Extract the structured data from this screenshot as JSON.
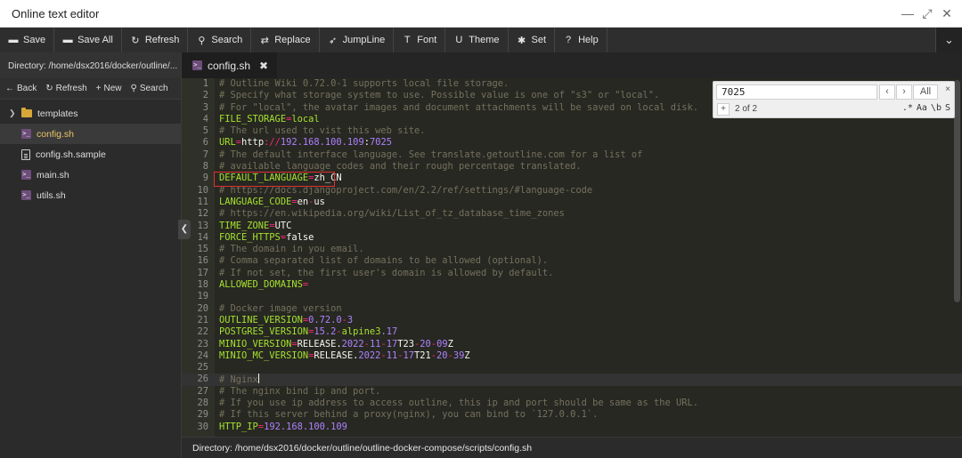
{
  "window": {
    "title": "Online text editor"
  },
  "toolbar": [
    {
      "label": "Save",
      "icon": "▬"
    },
    {
      "label": "Save All",
      "icon": "▬"
    },
    {
      "label": "Refresh",
      "icon": "↻"
    },
    {
      "label": "Search",
      "icon": "⚲"
    },
    {
      "label": "Replace",
      "icon": "⇄"
    },
    {
      "label": "JumpLine",
      "icon": "➶"
    },
    {
      "label": "Font",
      "icon": "T"
    },
    {
      "label": "Theme",
      "icon": "U"
    },
    {
      "label": "Set",
      "icon": "✱"
    },
    {
      "label": "Help",
      "icon": "?"
    }
  ],
  "sidebar": {
    "directory": "Directory: /home/dsx2016/docker/outline/...",
    "actions": [
      {
        "label": "Back",
        "icon": "←"
      },
      {
        "label": "Refresh",
        "icon": "↻"
      },
      {
        "label": "New",
        "icon": "+"
      },
      {
        "label": "Search",
        "icon": "⚲"
      }
    ],
    "items": [
      {
        "label": "templates",
        "type": "folder"
      },
      {
        "label": "config.sh",
        "type": "sh",
        "active": true
      },
      {
        "label": "config.sh.sample",
        "type": "doc"
      },
      {
        "label": "main.sh",
        "type": "sh"
      },
      {
        "label": "utils.sh",
        "type": "sh"
      }
    ]
  },
  "tab": {
    "label": "config.sh",
    "close": "✖"
  },
  "search": {
    "query": "7025",
    "prev": "‹",
    "next": "›",
    "all": "All",
    "close": "×",
    "plus": "+",
    "count": "2 of 2",
    "options": [
      ".*",
      "Aa",
      "\\b",
      "S"
    ]
  },
  "editor": {
    "current_line": 26,
    "lines": [
      [
        [
          "c-cm",
          "# Outline Wiki 0.72.0-1 supports local file storage."
        ]
      ],
      [
        [
          "c-cm",
          "# Specify what storage system to use. Possible value is one of \"s3\" or \"local\"."
        ]
      ],
      [
        [
          "c-cm",
          "# For \"local\", the avatar images and document attachments will be saved on local disk."
        ]
      ],
      [
        [
          "c-key",
          "FILE_STORAGE"
        ],
        [
          "c-op",
          "="
        ],
        [
          "c-key",
          "local"
        ]
      ],
      [
        [
          "c-cm",
          "# The url used to vist this web site."
        ]
      ],
      [
        [
          "c-key",
          "URL"
        ],
        [
          "c-op",
          "="
        ],
        [
          "c-txt",
          "http"
        ],
        [
          "c-op",
          "://"
        ],
        [
          "c-num",
          "192.168.100.109"
        ],
        [
          "c-txt",
          ":"
        ],
        [
          "c-num",
          "7025"
        ]
      ],
      [
        [
          "c-cm",
          "# The default interface language. See translate.getoutline.com for a list of"
        ]
      ],
      [
        [
          "c-cm",
          "# available language codes and their rough percentage translated."
        ]
      ],
      [
        [
          "c-key",
          "DEFAULT_LANGUAGE"
        ],
        [
          "c-op",
          "="
        ],
        [
          "c-txt",
          "zh_CN"
        ]
      ],
      [
        [
          "c-cm",
          "# https://docs.djangoproject.com/en/2.2/ref/settings/#language-code"
        ]
      ],
      [
        [
          "c-key",
          "LANGUAGE_CODE"
        ],
        [
          "c-op",
          "="
        ],
        [
          "c-txt",
          "en"
        ],
        [
          "c-op",
          "-"
        ],
        [
          "c-txt",
          "us"
        ]
      ],
      [
        [
          "c-cm",
          "# https://en.wikipedia.org/wiki/List_of_tz_database_time_zones"
        ]
      ],
      [
        [
          "c-key",
          "TIME_ZONE"
        ],
        [
          "c-op",
          "="
        ],
        [
          "c-txt",
          "UTC"
        ]
      ],
      [
        [
          "c-key",
          "FORCE_HTTPS"
        ],
        [
          "c-op",
          "="
        ],
        [
          "c-txt",
          "false"
        ]
      ],
      [
        [
          "c-cm",
          "# The domain in you email."
        ]
      ],
      [
        [
          "c-cm",
          "# Comma separated list of domains to be allowed (optional)."
        ]
      ],
      [
        [
          "c-cm",
          "# If not set, the first user's domain is allowed by default."
        ]
      ],
      [
        [
          "c-key",
          "ALLOWED_DOMAINS"
        ],
        [
          "c-op",
          "="
        ]
      ],
      [],
      [
        [
          "c-cm",
          "# Docker image version"
        ]
      ],
      [
        [
          "c-key",
          "OUTLINE_VERSION"
        ],
        [
          "c-op",
          "="
        ],
        [
          "c-num",
          "0.72.0"
        ],
        [
          "c-op",
          "-"
        ],
        [
          "c-num",
          "3"
        ]
      ],
      [
        [
          "c-key",
          "POSTGRES_VERSION"
        ],
        [
          "c-op",
          "="
        ],
        [
          "c-num",
          "15.2"
        ],
        [
          "c-op",
          "-"
        ],
        [
          "c-key",
          "alpine3"
        ],
        [
          "c-num",
          ".17"
        ]
      ],
      [
        [
          "c-key",
          "MINIO_VERSION"
        ],
        [
          "c-op",
          "="
        ],
        [
          "c-txt",
          "RELEASE."
        ],
        [
          "c-num",
          "2022"
        ],
        [
          "c-op",
          "-"
        ],
        [
          "c-num",
          "11"
        ],
        [
          "c-op",
          "-"
        ],
        [
          "c-num",
          "17"
        ],
        [
          "c-txt",
          "T23"
        ],
        [
          "c-op",
          "-"
        ],
        [
          "c-num",
          "20"
        ],
        [
          "c-op",
          "-"
        ],
        [
          "c-num",
          "09"
        ],
        [
          "c-txt",
          "Z"
        ]
      ],
      [
        [
          "c-key",
          "MINIO_MC_VERSION"
        ],
        [
          "c-op",
          "="
        ],
        [
          "c-txt",
          "RELEASE."
        ],
        [
          "c-num",
          "2022"
        ],
        [
          "c-op",
          "-"
        ],
        [
          "c-num",
          "11"
        ],
        [
          "c-op",
          "-"
        ],
        [
          "c-num",
          "17"
        ],
        [
          "c-txt",
          "T21"
        ],
        [
          "c-op",
          "-"
        ],
        [
          "c-num",
          "20"
        ],
        [
          "c-op",
          "-"
        ],
        [
          "c-num",
          "39"
        ],
        [
          "c-txt",
          "Z"
        ]
      ],
      [],
      [
        [
          "c-cm",
          "# Nginx"
        ]
      ],
      [
        [
          "c-cm",
          "# The nginx bind ip and port."
        ]
      ],
      [
        [
          "c-cm",
          "# If you use ip address to access outline, this ip and port should be same as the URL."
        ]
      ],
      [
        [
          "c-cm",
          "# If this server behind a proxy(nginx), you can bind to `127.0.0.1`."
        ]
      ],
      [
        [
          "c-key",
          "HTTP_IP"
        ],
        [
          "c-op",
          "="
        ],
        [
          "c-num",
          "192.168.100.109"
        ]
      ]
    ]
  },
  "status": {
    "path": "Directory: /home/dsx2016/docker/outline/outline-docker-compose/scripts/config.sh"
  }
}
